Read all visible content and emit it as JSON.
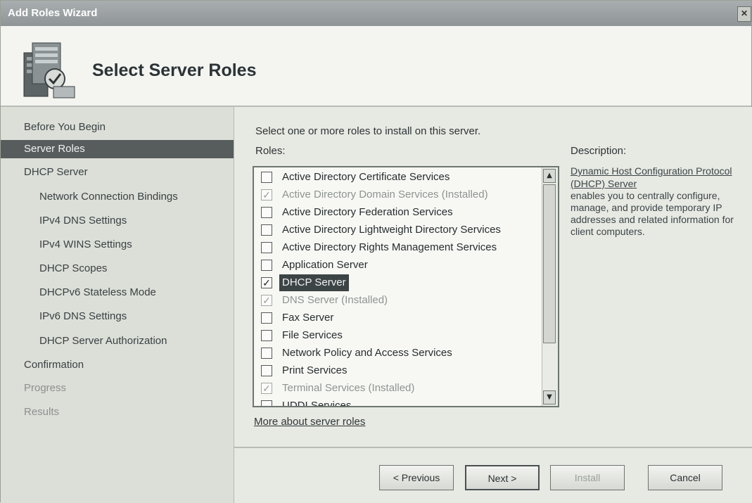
{
  "window": {
    "title": "Add Roles Wizard",
    "close_glyph": "✕"
  },
  "header": {
    "title": "Select Server Roles",
    "icon": "server-roles-icon"
  },
  "sidebar": {
    "items": [
      {
        "label": "Before You Begin",
        "state": "normal"
      },
      {
        "label": "Server Roles",
        "state": "selected"
      },
      {
        "label": "DHCP Server",
        "state": "normal"
      },
      {
        "label": "Network Connection Bindings",
        "state": "normal"
      },
      {
        "label": "IPv4 DNS Settings",
        "state": "normal"
      },
      {
        "label": "IPv4 WINS Settings",
        "state": "normal"
      },
      {
        "label": "DHCP Scopes",
        "state": "normal"
      },
      {
        "label": "DHCPv6 Stateless Mode",
        "state": "normal"
      },
      {
        "label": "IPv6 DNS Settings",
        "state": "normal"
      },
      {
        "label": "DHCP Server Authorization",
        "state": "normal"
      },
      {
        "label": "Confirmation",
        "state": "normal"
      },
      {
        "label": "Progress",
        "state": "dim"
      },
      {
        "label": "Results",
        "state": "dim"
      }
    ]
  },
  "main": {
    "instruction": "Select one or more roles to install on this server.",
    "roles_label": "Roles:",
    "roles": [
      {
        "label": "Active Directory Certificate Services",
        "checked": false,
        "installed": false
      },
      {
        "label": "Active Directory Domain Services  (Installed)",
        "checked": true,
        "installed": true
      },
      {
        "label": "Active Directory Federation Services",
        "checked": false,
        "installed": false
      },
      {
        "label": "Active Directory Lightweight Directory Services",
        "checked": false,
        "installed": false
      },
      {
        "label": "Active Directory Rights Management Services",
        "checked": false,
        "installed": false
      },
      {
        "label": "Application Server",
        "checked": false,
        "installed": false
      },
      {
        "label": "DHCP Server",
        "checked": true,
        "installed": false,
        "highlight": true
      },
      {
        "label": "DNS Server  (Installed)",
        "checked": true,
        "installed": true
      },
      {
        "label": "Fax Server",
        "checked": false,
        "installed": false
      },
      {
        "label": "File Services",
        "checked": false,
        "installed": false
      },
      {
        "label": "Network Policy and Access Services",
        "checked": false,
        "installed": false
      },
      {
        "label": "Print Services",
        "checked": false,
        "installed": false
      },
      {
        "label": "Terminal Services  (Installed)",
        "checked": true,
        "installed": true
      },
      {
        "label": "UDDI Services",
        "checked": false,
        "installed": false
      }
    ],
    "description_title": "Description:",
    "description_link": "Dynamic Host Configuration Protocol (DHCP) Server",
    "description_text": "enables you to centrally configure, manage, and provide temporary IP addresses and related information for client computers.",
    "more_link": "More about server roles"
  },
  "buttons": {
    "previous": "< Previous",
    "next": "Next >",
    "install": "Install",
    "cancel": "Cancel"
  },
  "glyphs": {
    "check": "✓",
    "scroll_up": "▲",
    "scroll_down": "▼"
  }
}
